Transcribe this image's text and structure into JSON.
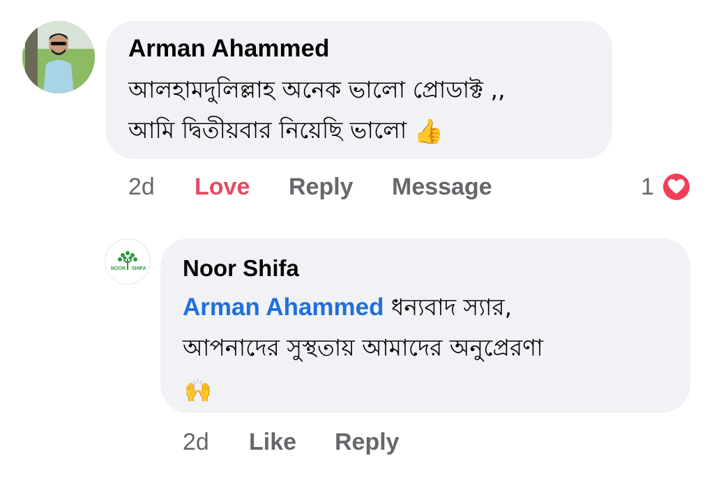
{
  "comments": [
    {
      "author": "Arman Ahammed",
      "text_line1": "আলহামদুলিল্লাহ অনেক ভালো প্রোডাক্ট ,,",
      "text_line2": "আমি দ্বিতীয়বার নিয়েছি ভালো",
      "emoji": "👍",
      "time": "2d",
      "reaction_label": "Love",
      "reply_label": "Reply",
      "message_label": "Message",
      "reaction_count": "1",
      "reaction_icon": "love-heart-icon",
      "colors": {
        "reaction_active": "#e64a63",
        "heart_badge": "#f33e58"
      }
    },
    {
      "author": "Noor Shifa",
      "logo_text_left": "NOOR",
      "logo_text_right": "SHIFA",
      "mention": "Arman Ahammed",
      "text_after_mention": " ধন্যবাদ স্যার,",
      "text_line2": "আপনাদের সুস্থতায় আমাদের অনুপ্রেরণা",
      "emoji": "🙌",
      "time": "2d",
      "like_label": "Like",
      "reply_label": "Reply",
      "colors": {
        "mention": "#216fdb"
      }
    }
  ],
  "colors": {
    "bubble": "#f0f2f5",
    "meta_text": "#65676b",
    "logo_green": "#2e9a3e"
  }
}
